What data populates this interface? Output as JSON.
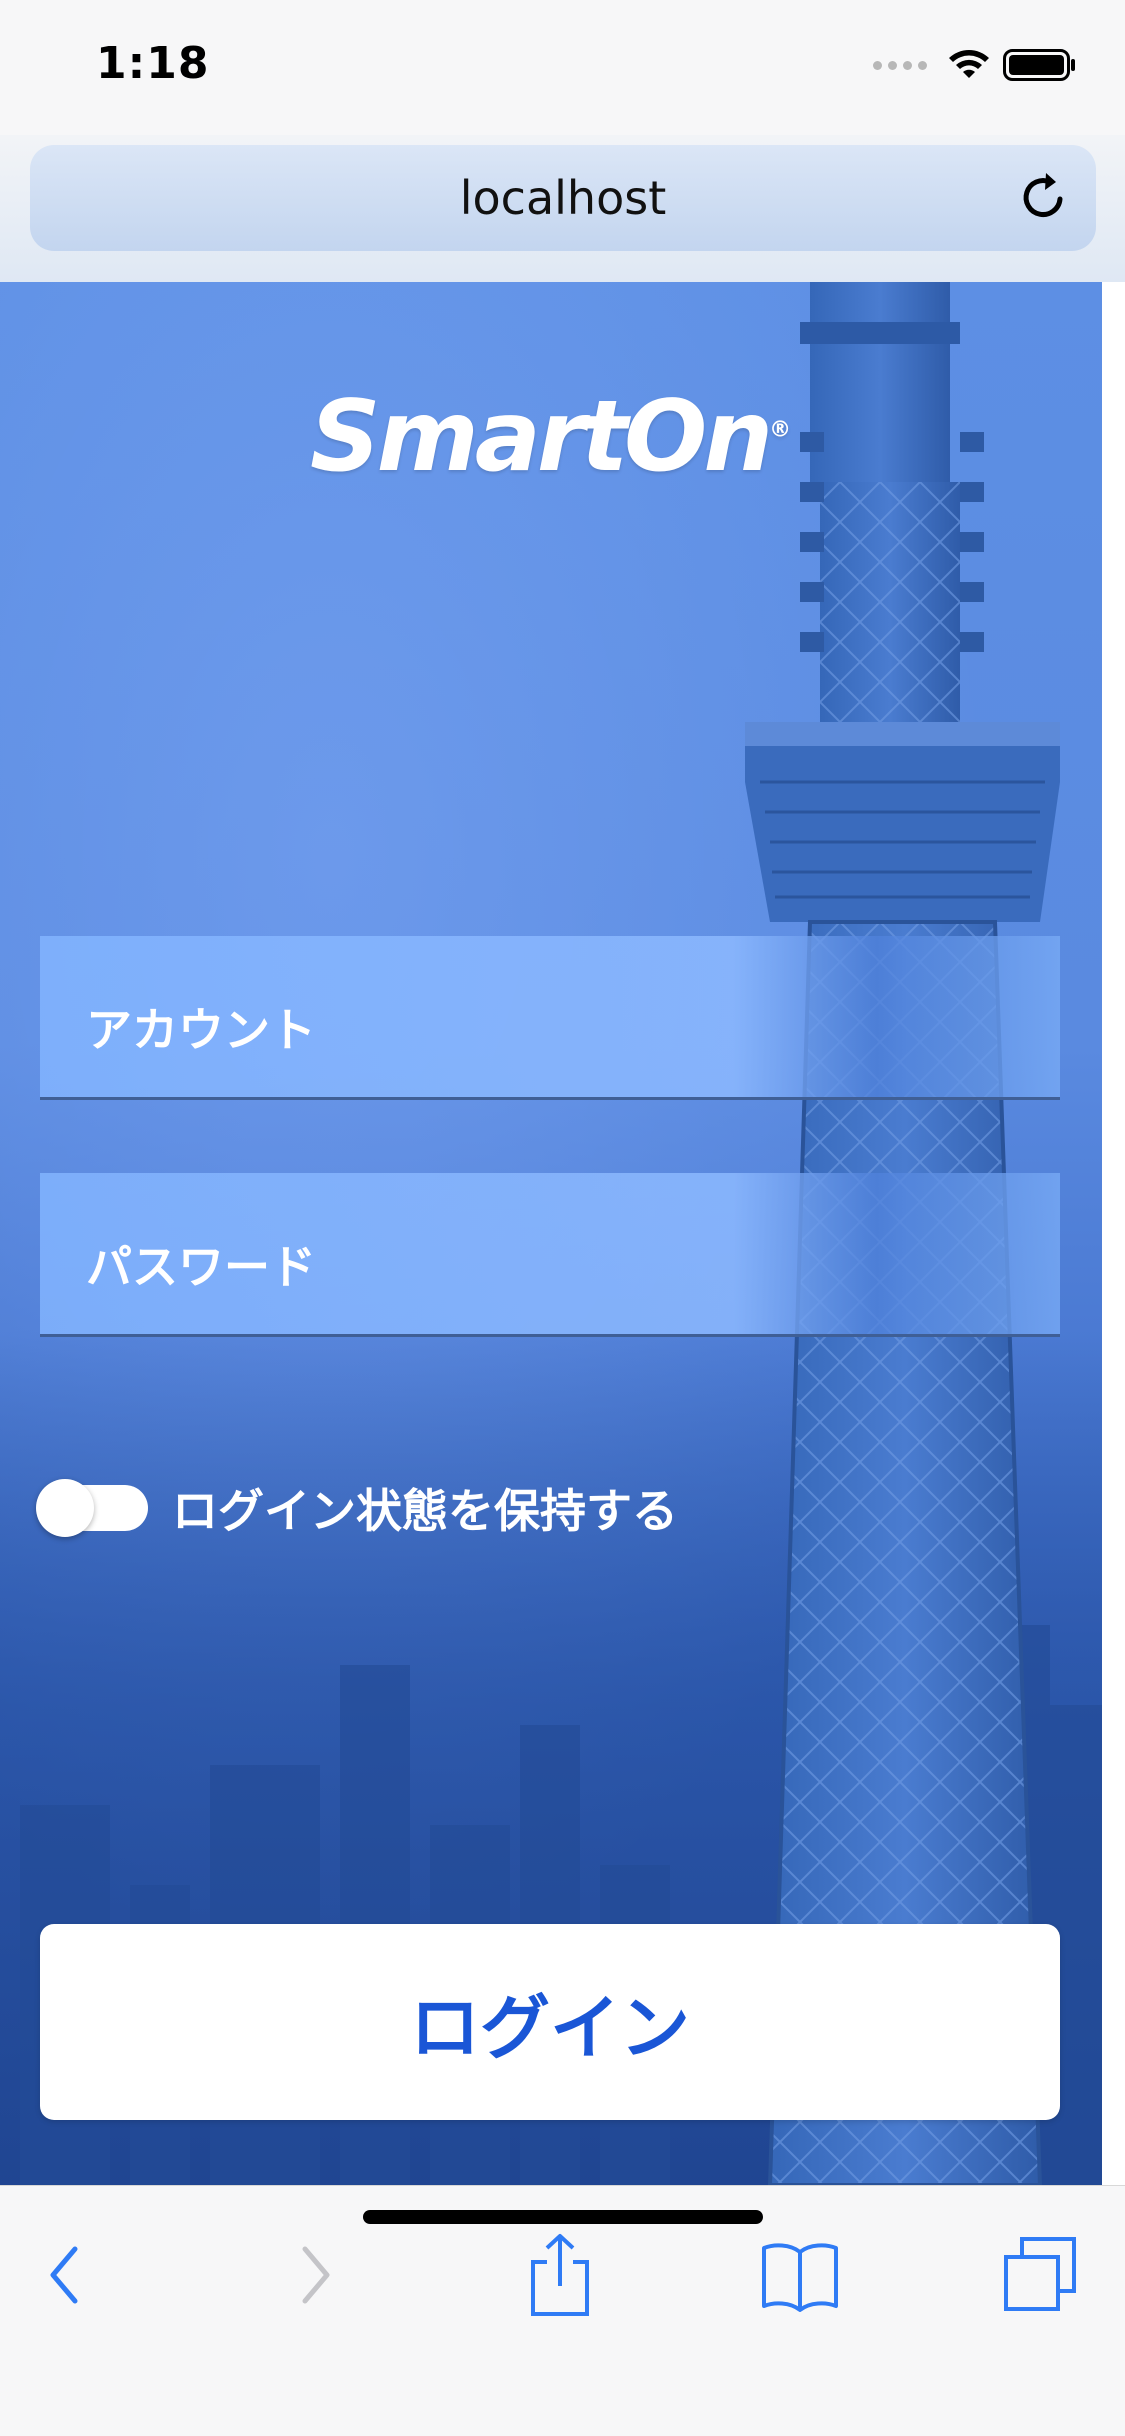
{
  "status_bar": {
    "time": "1:18"
  },
  "browser": {
    "url": "localhost"
  },
  "login": {
    "logo": {
      "name": "SmartOn",
      "mark": "®"
    },
    "account_placeholder": "アカウント",
    "password_placeholder": "パスワード",
    "remember_label": "ログイン状態を保持する",
    "remember_on": false,
    "login_button": "ログイン"
  },
  "colors": {
    "accent": "#1a56d6",
    "background_blue": "#5a8ae0",
    "safari_tint": "#2f7bf5"
  },
  "icons": {
    "reload": "reload-icon",
    "back": "chevron-left-icon",
    "forward": "chevron-right-icon",
    "share": "share-icon",
    "bookmarks": "book-icon",
    "tabs": "tabs-icon"
  }
}
